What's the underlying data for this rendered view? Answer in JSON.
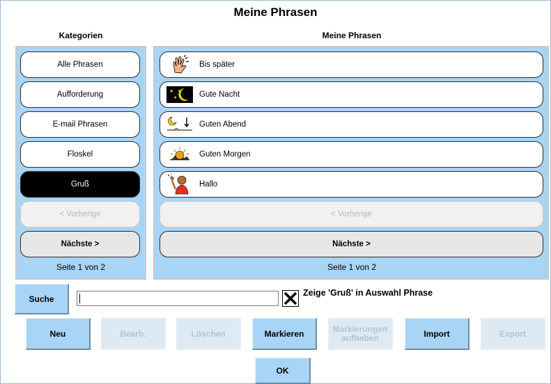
{
  "dialog": {
    "title": "Meine Phrasen"
  },
  "categories": {
    "header": "Kategorien",
    "items": [
      {
        "label": "Alle Phrasen"
      },
      {
        "label": "Aufforderung"
      },
      {
        "label": "E-mail Phrasen"
      },
      {
        "label": "Floskel"
      },
      {
        "label": "Gruß"
      }
    ],
    "selected": "Gruß",
    "prev_label": "< Vorherige",
    "next_label": "Nächste >",
    "page_label": "Seite 1 von 2"
  },
  "phrases": {
    "header": "Meine Phrasen",
    "items": [
      {
        "label": "Bis später",
        "icon": "waving-hand-icon"
      },
      {
        "label": "Gute Nacht",
        "icon": "moon-stars-icon"
      },
      {
        "label": "Guten Abend",
        "icon": "moon-sunset-icon"
      },
      {
        "label": "Guten Morgen",
        "icon": "sunrise-icon"
      },
      {
        "label": "Hallo",
        "icon": "person-waving-icon"
      }
    ],
    "prev_label": "< Vorherige",
    "next_label": "Nächste >",
    "page_label": "Seite 1 von 2"
  },
  "search": {
    "button_label": "Suche",
    "value": ""
  },
  "filter": {
    "checked": true,
    "label": "Zeige 'Gruß' in Auswahl Phrase"
  },
  "actions": {
    "new": "Neu",
    "edit": "Bearb.",
    "delete": "Löschen",
    "mark": "Markieren",
    "unmark_line1": "Markierungen",
    "unmark_line2": "aufheben",
    "import": "Import",
    "export": "Export",
    "ok": "OK"
  },
  "colors": {
    "panel": "#a8d4f6",
    "selected": "#000000",
    "disabled_text": "#b8b8b8"
  }
}
